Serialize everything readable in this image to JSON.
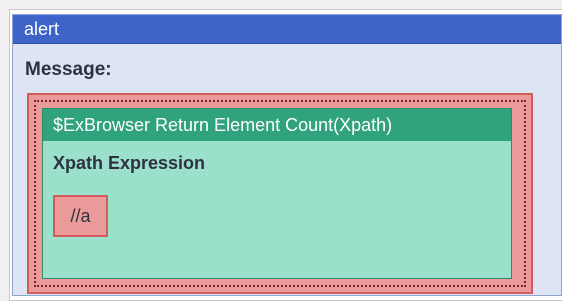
{
  "alert": {
    "title": "alert",
    "message_label": "Message:",
    "function": {
      "name": "$ExBrowser Return Element Count(Xpath)",
      "parameter_label": "Xpath Expression",
      "parameter_value": "//a"
    }
  },
  "colors": {
    "header_blue": "#3f64c9",
    "panel_blue": "#dde4f3",
    "slot_red": "#eb9a9a",
    "function_green": "#30a27e",
    "function_body": "#9ae0cb"
  }
}
